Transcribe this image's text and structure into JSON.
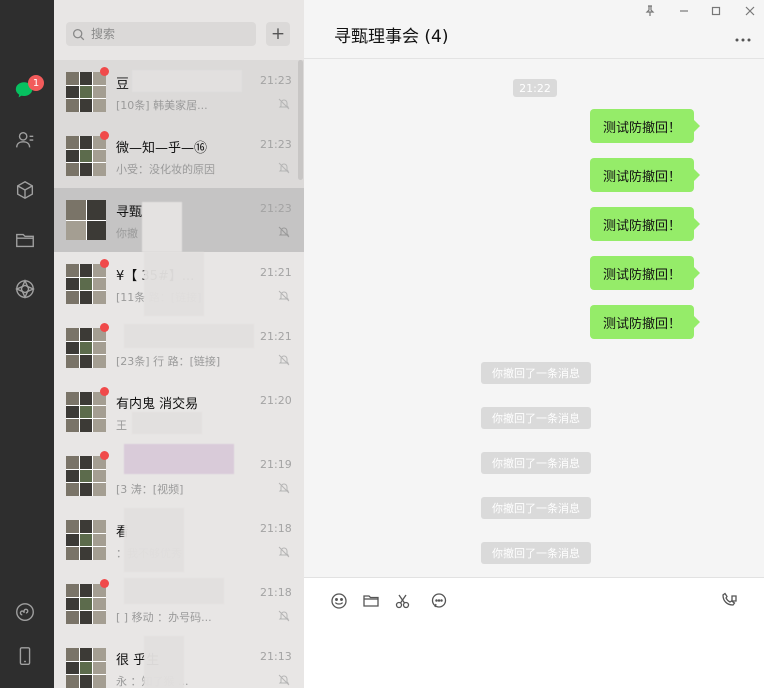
{
  "sidebar": {
    "unread_count": "1",
    "icons": [
      "chat-icon",
      "contacts-icon",
      "favorites-icon",
      "files-icon",
      "moments-icon",
      "miniprogram-icon",
      "phone-icon"
    ]
  },
  "search": {
    "placeholder": "搜索",
    "add_label": "+"
  },
  "chats": [
    {
      "name": "豆",
      "time": "21:23",
      "preview": "[10条] 韩美家居...",
      "badge": true
    },
    {
      "name": "微—知—乎—⑯",
      "time": "21:23",
      "preview": "小受：没化妆的原因",
      "badge": true
    },
    {
      "name": "寻甄",
      "time": "21:23",
      "preview": "你撤",
      "badge": false
    },
    {
      "name": "¥【 35#】...",
      "time": "21:21",
      "preview": "[11条 路：[链接]",
      "badge": true
    },
    {
      "name": "",
      "time": "21:21",
      "preview": "[23条] 行 路：[链接]",
      "badge": true
    },
    {
      "name": "有内鬼 消交易",
      "time": "21:20",
      "preview": "王",
      "badge": true
    },
    {
      "name": "",
      "time": "21:19",
      "preview": "[3 涛：[视频]",
      "badge": true
    },
    {
      "name": "看",
      "time": "21:18",
      "preview": "：我不够优秀",
      "badge": false
    },
    {
      "name": "",
      "time": "21:18",
      "preview": "[ ] 移动 ：办号码...",
      "badge": true
    },
    {
      "name": "很 乎生",
      "time": "21:13",
      "preview": "永 ：知了猴 ...",
      "badge": false
    }
  ],
  "window": {
    "title": "寻甄理事会 (4)"
  },
  "messages": {
    "time_divider": "21:22",
    "sent": [
      "测试防撤回！",
      "测试防撤回！",
      "测试防撤回！",
      "测试防撤回！",
      "测试防撤回！"
    ],
    "recalled": [
      "你撤回了一条消息",
      "你撤回了一条消息",
      "你撤回了一条消息",
      "你撤回了一条消息",
      "你撤回了一条消息"
    ]
  },
  "toolbar": {
    "icons": [
      "emoji-icon",
      "folder-icon",
      "scissors-icon",
      "chat-bubble-icon",
      "video-call-icon"
    ]
  },
  "colors": {
    "sent_bubble": "#95ec69",
    "rail": "#2e2e2e",
    "badge": "#f25b5b"
  }
}
